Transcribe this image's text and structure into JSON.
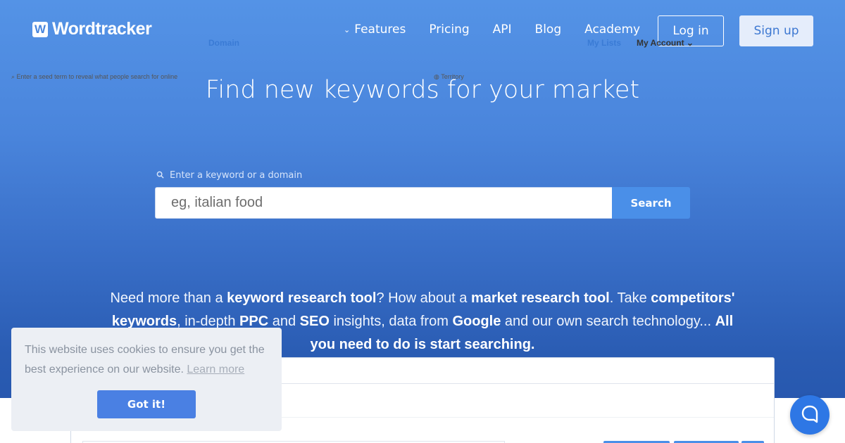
{
  "header": {
    "logo_mark": "W",
    "logo_text": "Wordtracker",
    "nav": [
      {
        "label": "Features",
        "has_chevron": true
      },
      {
        "label": "Pricing"
      },
      {
        "label": "API"
      },
      {
        "label": "Blog"
      },
      {
        "label": "Academy"
      }
    ],
    "login_label": "Log in",
    "signup_label": "Sign up"
  },
  "hero": {
    "title": "Find new keywords for your market",
    "search_label": "Enter a keyword or a domain",
    "search_placeholder": "eg, italian food",
    "search_button": "Search"
  },
  "description": {
    "segments": [
      {
        "text": "Need more than a ",
        "bold": false
      },
      {
        "text": "keyword research tool",
        "bold": true
      },
      {
        "text": "? How about a ",
        "bold": false
      },
      {
        "text": "market research tool",
        "bold": true
      },
      {
        "text": ". Take ",
        "bold": false
      },
      {
        "text": "competitors' keywords",
        "bold": true
      },
      {
        "text": ", in-depth ",
        "bold": false
      },
      {
        "text": "PPC",
        "bold": true
      },
      {
        "text": " and ",
        "bold": false
      },
      {
        "text": "SEO",
        "bold": true
      },
      {
        "text": " insights, data from ",
        "bold": false
      },
      {
        "text": "Google",
        "bold": true
      },
      {
        "text": " and our own",
        "bold": false
      },
      {
        "text": " search technology... ",
        "bold": false
      },
      {
        "text": "All you need to do is start searching.",
        "bold": true
      }
    ]
  },
  "preview": {
    "tab_label": "Domain",
    "my_lists": "My Lists",
    "my_account": "My Account",
    "seed_hint": "Enter a seed term to reveal what people search for online",
    "territory": "Territory"
  },
  "cookie": {
    "text": "This website uses cookies to ensure you get the best experience on our website.",
    "link": "Learn more",
    "button": "Got it!"
  },
  "colors": {
    "brand_blue": "#4a8fe8",
    "header_blue": "#5493e6",
    "cookie_button": "#4a80e3"
  }
}
